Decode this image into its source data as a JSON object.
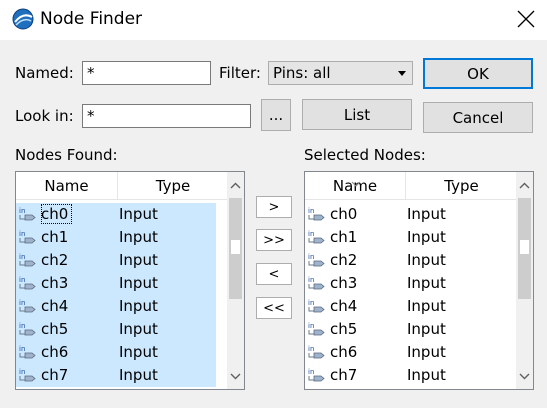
{
  "window": {
    "title": "Node Finder"
  },
  "named": {
    "label": "Named:",
    "value": "*"
  },
  "filter": {
    "label": "Filter:",
    "value": "Pins: all"
  },
  "look_in": {
    "label": "Look in:",
    "value": "*",
    "browse_label": "..."
  },
  "buttons": {
    "ok": "OK",
    "list": "List",
    "cancel": "Cancel"
  },
  "nodes_found": {
    "label": "Nodes Found:",
    "columns": [
      "Name",
      "Type"
    ],
    "rows": [
      {
        "name": "ch0",
        "type": "Input"
      },
      {
        "name": "ch1",
        "type": "Input"
      },
      {
        "name": "ch2",
        "type": "Input"
      },
      {
        "name": "ch3",
        "type": "Input"
      },
      {
        "name": "ch4",
        "type": "Input"
      },
      {
        "name": "ch5",
        "type": "Input"
      },
      {
        "name": "ch6",
        "type": "Input"
      },
      {
        "name": "ch7",
        "type": "Input"
      }
    ]
  },
  "selected_nodes": {
    "label": "Selected Nodes:",
    "columns": [
      "Name",
      "Type"
    ],
    "rows": [
      {
        "name": "ch0",
        "type": "Input"
      },
      {
        "name": "ch1",
        "type": "Input"
      },
      {
        "name": "ch2",
        "type": "Input"
      },
      {
        "name": "ch3",
        "type": "Input"
      },
      {
        "name": "ch4",
        "type": "Input"
      },
      {
        "name": "ch5",
        "type": "Input"
      },
      {
        "name": "ch6",
        "type": "Input"
      },
      {
        "name": "ch7",
        "type": "Input"
      }
    ]
  },
  "transfer": {
    "add": ">",
    "add_all": ">>",
    "remove": "<",
    "remove_all": "<<"
  },
  "icons": {
    "app": "node-finder-app-icon",
    "close": "close-icon",
    "pin": "input-pin-icon",
    "pin_label": "in",
    "scroll_up": "chevron-up-icon",
    "scroll_down": "chevron-down-icon",
    "sort": "sort-indicator-icon"
  },
  "colors": {
    "selection": "#cce8ff",
    "default_button_border": "#0078d7",
    "background": "#f0f0f0"
  }
}
